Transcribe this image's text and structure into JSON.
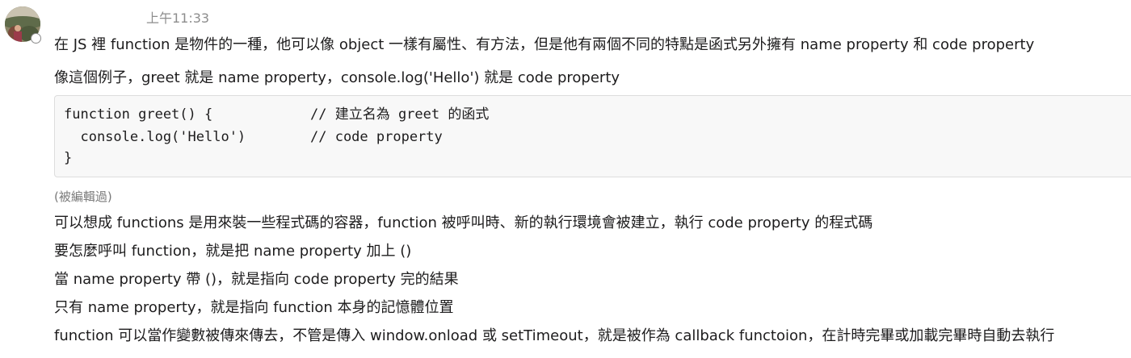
{
  "message": {
    "avatar_icon": "user-avatar-photo",
    "presence": "away",
    "timestamp": "上午11:33",
    "lines_before_code": [
      "在 JS 裡 function 是物件的一種，他可以像 object 一樣有屬性、有方法，但是他有兩個不同的特點是函式另外擁有 name property 和 code property",
      "像這個例子，greet 就是 name property，console.log('Hello') 就是 code property"
    ],
    "code": {
      "lines": [
        {
          "code": "function greet() {",
          "comment": "// 建立名為 greet 的函式"
        },
        {
          "code": "  console.log('Hello')",
          "comment": "// code property"
        },
        {
          "code": "}",
          "comment": ""
        }
      ]
    },
    "edited_label": "(被編輯過)",
    "lines_after_code": [
      "可以想成 functions 是用來裝一些程式碼的容器，function 被呼叫時、新的執行環境會被建立，執行 code property 的程式碼",
      "要怎麼呼叫 function，就是把 name property 加上 ()",
      "當 name property 帶 ()，就是指向 code property 完的結果",
      "只有 name property，就是指向 function 本身的記憶體位置",
      "function 可以當作變數被傳來傳去，不管是傳入 window.onload 或 setTimeout，就是被作為 callback functoion，在計時完畢或加載完畢時自動去執行"
    ]
  }
}
